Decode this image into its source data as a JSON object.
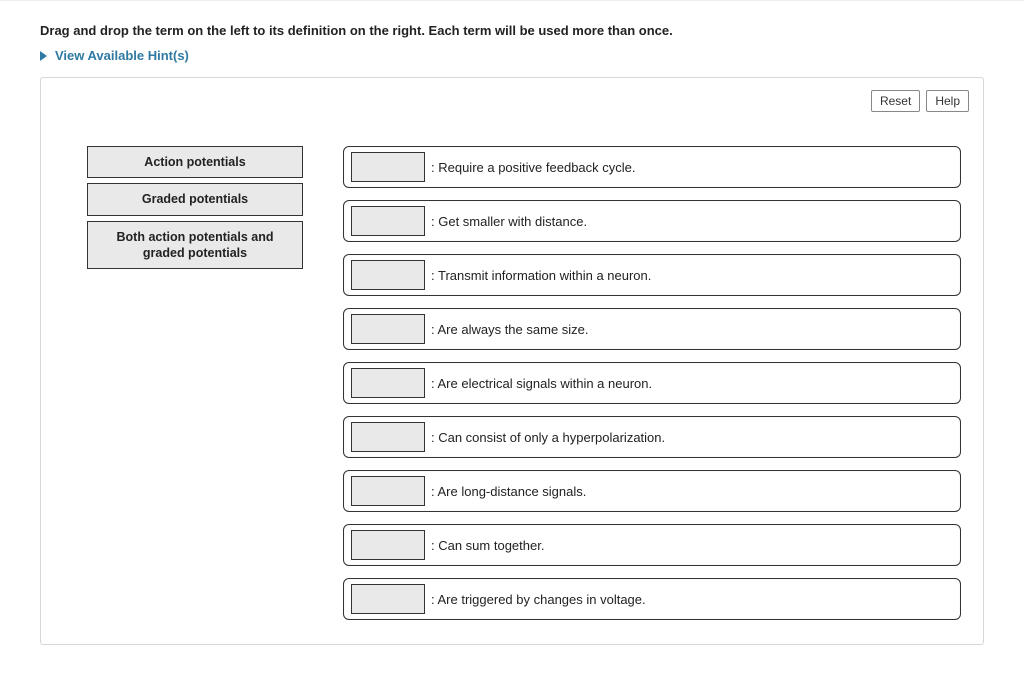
{
  "instructions": "Drag and drop the term on the left to its definition on the right. Each term will be used more than once.",
  "hints_label": "View Available Hint(s)",
  "buttons": {
    "reset": "Reset",
    "help": "Help"
  },
  "terms": [
    "Action potentials",
    "Graded potentials",
    "Both action potentials and graded potentials"
  ],
  "definitions": [
    ": Require a positive feedback cycle.",
    ": Get smaller with distance.",
    ": Transmit information within a neuron.",
    ": Are always the same size.",
    ": Are electrical signals within a neuron.",
    ": Can consist of only a hyperpolarization.",
    ": Are long-distance signals.",
    ": Can sum together.",
    ": Are triggered by changes in voltage."
  ]
}
